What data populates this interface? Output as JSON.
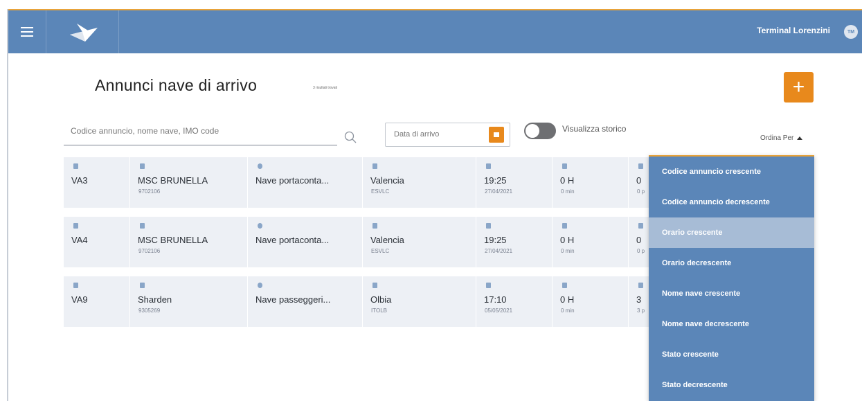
{
  "header": {
    "terminal_name": "Terminal Lorenzini",
    "user_initials": "TM"
  },
  "page": {
    "title": "Annunci nave di arrivo",
    "result_count": "3 risultati trovati",
    "add_label": "+"
  },
  "filters": {
    "search_placeholder": "Codice annuncio, nome nave, IMO code",
    "date_placeholder": "Data di arrivo",
    "history_toggle_label": "Visualizza storico",
    "history_toggle_on": false,
    "sort_label": "Ordina Per"
  },
  "rows": [
    {
      "code": "VA3",
      "ship_name": "MSC BRUNELLA",
      "imo": "9702106",
      "ship_type": "Nave portaconta...",
      "port": "Valencia",
      "port_code": "ESVLC",
      "time": "19:25",
      "date": "27/04/2021",
      "duration_h": "0 H",
      "duration_min": "0 min",
      "count": "0",
      "count_sub": "0 p"
    },
    {
      "code": "VA4",
      "ship_name": "MSC BRUNELLA",
      "imo": "9702106",
      "ship_type": "Nave portaconta...",
      "port": "Valencia",
      "port_code": "ESVLC",
      "time": "19:25",
      "date": "27/04/2021",
      "duration_h": "0 H",
      "duration_min": "0 min",
      "count": "0",
      "count_sub": "0 p"
    },
    {
      "code": "VA9",
      "ship_name": "Sharden",
      "imo": "9305269",
      "ship_type": "Nave passeggeri...",
      "port": "Olbia",
      "port_code": "ITOLB",
      "time": "17:10",
      "date": "05/05/2021",
      "duration_h": "0 H",
      "duration_min": "0 min",
      "count": "3",
      "count_sub": "3 p"
    }
  ],
  "sort_options": [
    "Codice annuncio crescente",
    "Codice annuncio decrescente",
    "Orario crescente",
    "Orario decrescente",
    "Nome nave crescente",
    "Nome nave decrescente",
    "Stato crescente",
    "Stato decrescente"
  ],
  "sort_selected_index": 2,
  "colors": {
    "primary": "#5b86b8",
    "accent": "#e8891c",
    "row_bg": "#edf0f5",
    "icon": "#8aa6c8"
  },
  "icons": {
    "menu": "hamburger-icon",
    "logo": "paper-plane-logo",
    "search": "search-icon",
    "calendar": "calendar-icon",
    "code": "pin-icon",
    "ship": "ship-icon",
    "type": "info-icon",
    "port": "port-icon",
    "time": "calendar-icon",
    "duration": "hourglass-icon",
    "count": "people-icon"
  }
}
